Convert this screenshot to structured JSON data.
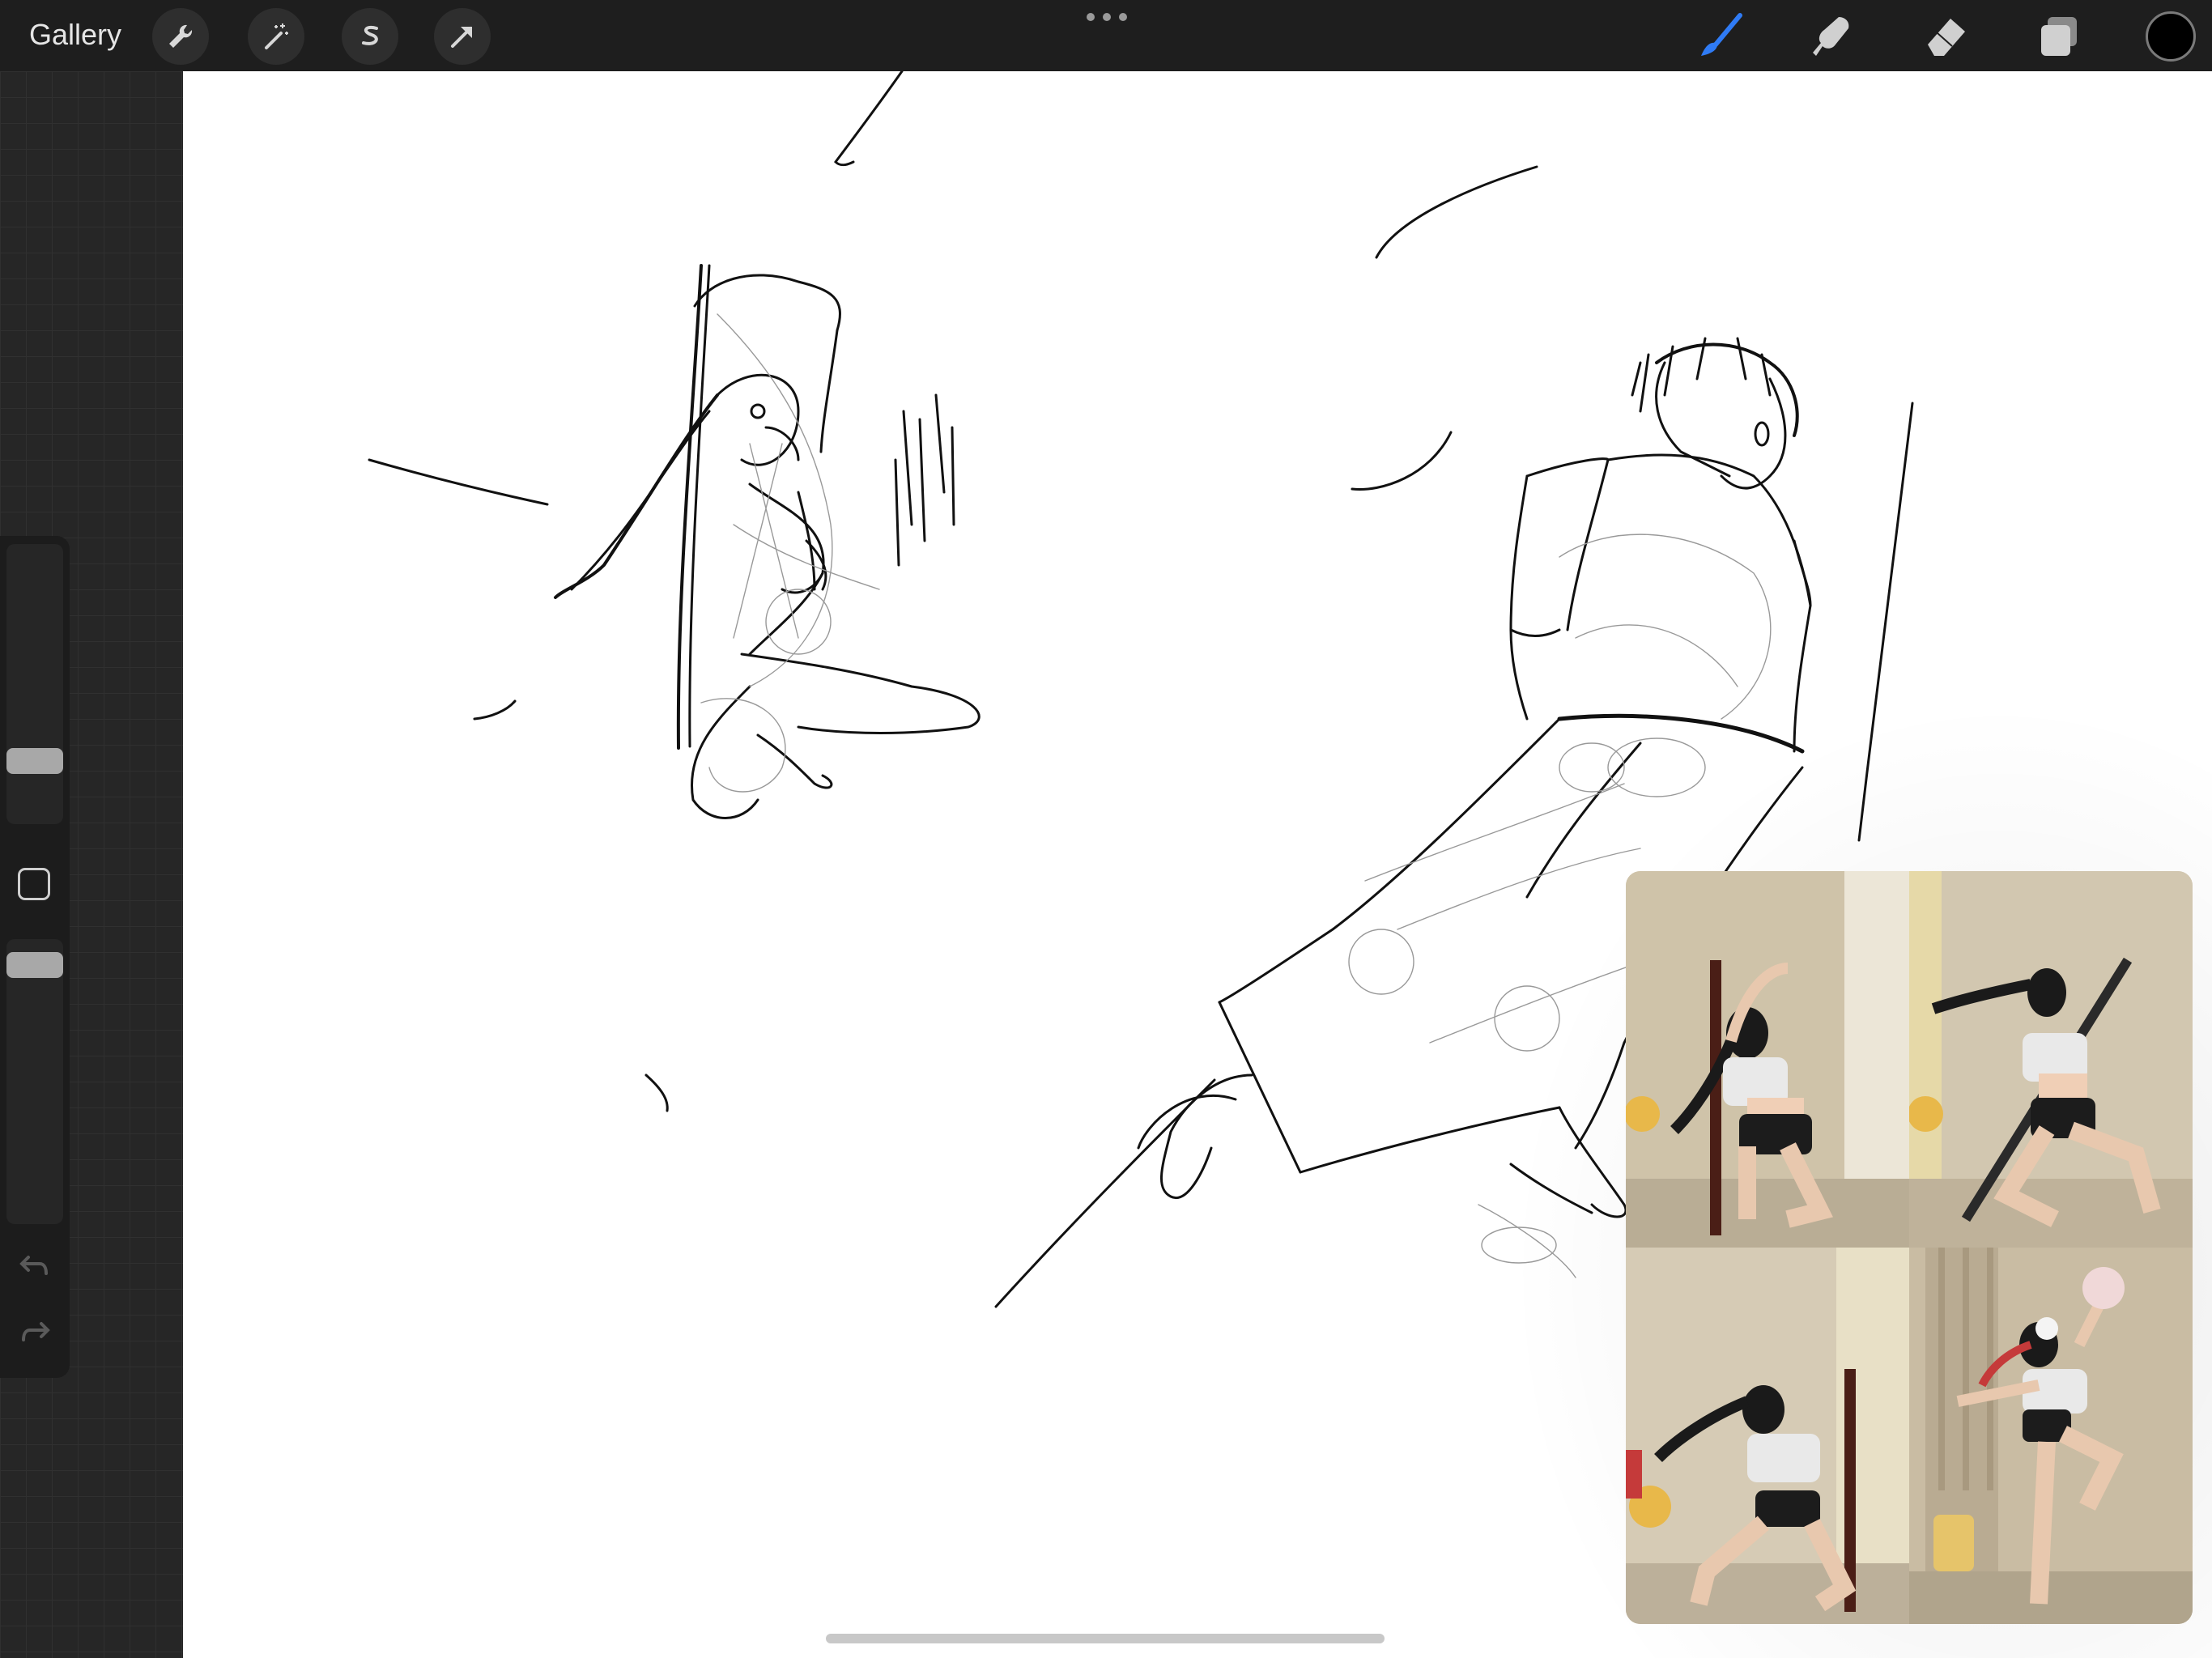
{
  "toolbar": {
    "gallery_label": "Gallery",
    "left_tools": [
      {
        "name": "actions-wrench-icon"
      },
      {
        "name": "adjustments-magic-wand-icon"
      },
      {
        "name": "selection-s-icon"
      },
      {
        "name": "transform-arrow-icon"
      }
    ],
    "right_tools": [
      {
        "name": "brush-icon",
        "active": true
      },
      {
        "name": "smudge-icon",
        "active": false
      },
      {
        "name": "eraser-icon",
        "active": false
      },
      {
        "name": "layers-icon",
        "active": false
      }
    ],
    "current_color": "#000000",
    "active_color": "#2f7bf5"
  },
  "sidebar": {
    "brush_size_level": 0.75,
    "opacity_level": 1.0
  },
  "reference_window": {
    "photos": [
      "pose-photo-1",
      "pose-photo-2",
      "pose-photo-3",
      "pose-photo-4"
    ]
  }
}
